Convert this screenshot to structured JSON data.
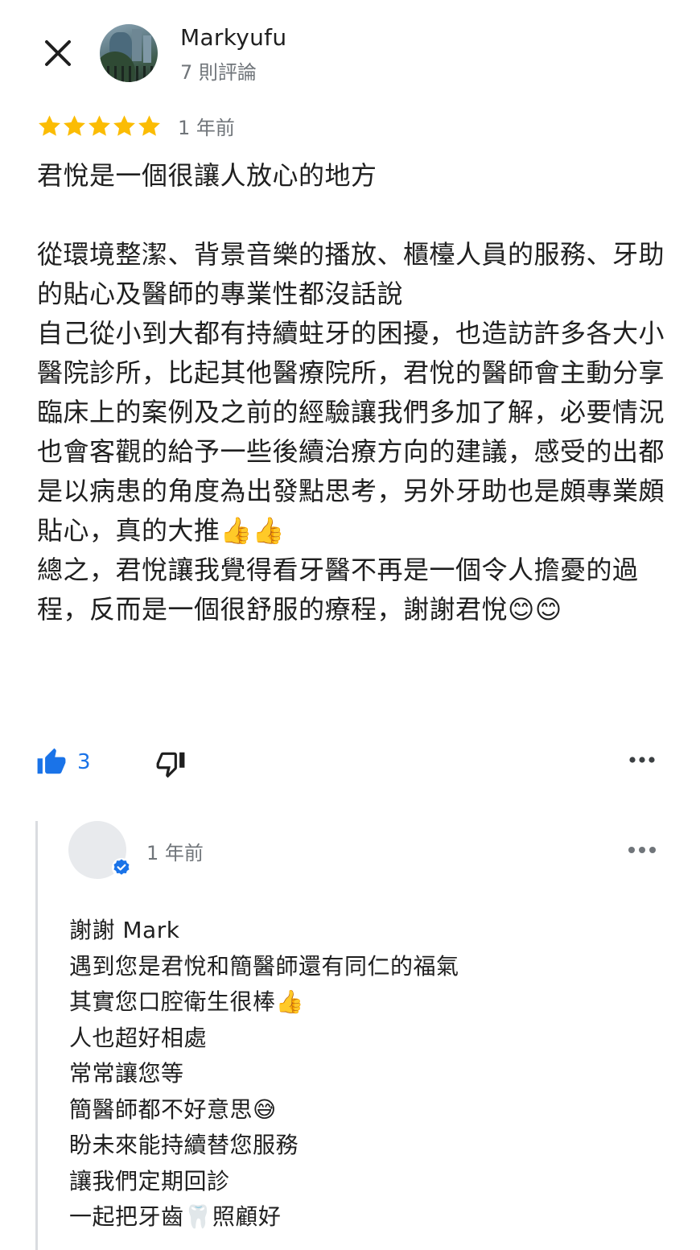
{
  "header": {
    "user_name": "Markyufu",
    "review_count": "7 則評論"
  },
  "review": {
    "rating": 5,
    "date": "1 年前",
    "paragraphs": [
      "君悅是一個很讓人放心的地方",
      "",
      "從環境整潔、背景音樂的播放、櫃檯人員的服務、牙助的貼心及醫師的專業性都沒話說",
      "自己從小到大都有持續蛀牙的困擾，也造訪許多各大小醫院診所，比起其他醫療院所，君悅的醫師會主動分享臨床上的案例及之前的經驗讓我們多加了解，必要情況也會客觀的給予一些後續治療方向的建議，感受的出都是以病患的角度為出發點思考，另外牙助也是頗專業頗貼心，真的大推👍👍",
      "總之，君悅讓我覺得看牙醫不再是一個令人擔憂的過程，反而是一個很舒服的療程，謝謝君悅😊😊"
    ]
  },
  "actions": {
    "like_count": "3"
  },
  "reply": {
    "date": "1 年前",
    "lines": [
      "謝謝 Mark",
      "遇到您是君悅和簡醫師還有同仁的福氣",
      "其實您口腔衛生很棒👍",
      "人也超好相處",
      "常常讓您等",
      "簡醫師都不好意思😅",
      "盼未來能持續替您服務",
      "讓我們定期回診",
      "一起把牙齒🦷照顧好"
    ]
  },
  "colors": {
    "star": "#fbbc04",
    "accent": "#1a73e8",
    "secondary_text": "#70757a",
    "thread_line": "#dadce0"
  },
  "icons": {
    "close": "close-icon",
    "star": "star-icon",
    "like": "thumb-up-icon",
    "dislike": "thumb-down-icon",
    "more": "more-horiz-icon",
    "verified": "verified-badge-icon"
  }
}
